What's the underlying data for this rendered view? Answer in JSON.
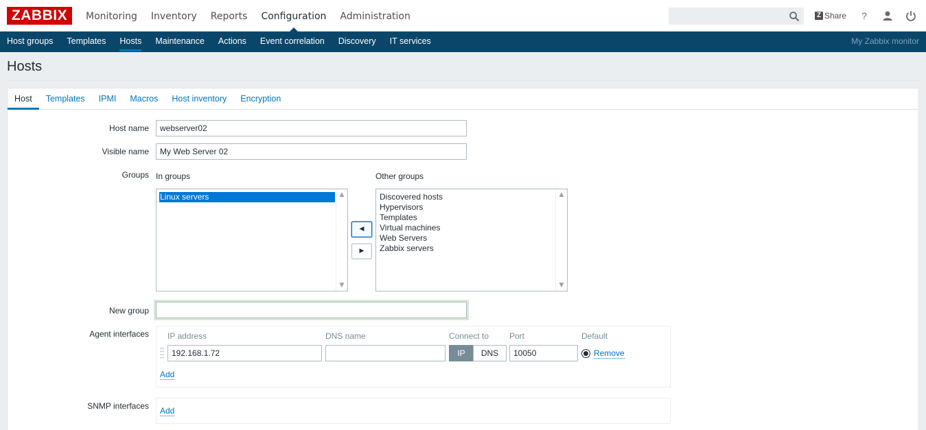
{
  "logo": "ZABBIX",
  "main_menu": [
    "Monitoring",
    "Inventory",
    "Reports",
    "Configuration",
    "Administration"
  ],
  "main_menu_active": "Configuration",
  "search": {
    "value": "",
    "placeholder": ""
  },
  "share_label": "Share",
  "sub_menu": [
    "Host groups",
    "Templates",
    "Hosts",
    "Maintenance",
    "Actions",
    "Event correlation",
    "Discovery",
    "IT services"
  ],
  "sub_menu_active": "Hosts",
  "server_name": "My Zabbix monitor",
  "page_title": "Hosts",
  "tabs": [
    "Host",
    "Templates",
    "IPMI",
    "Macros",
    "Host inventory",
    "Encryption"
  ],
  "tabs_active": "Host",
  "form": {
    "host_name_label": "Host name",
    "host_name_value": "webserver02",
    "visible_name_label": "Visible name",
    "visible_name_value": "My Web Server 02",
    "groups_label": "Groups",
    "in_groups_label": "In groups",
    "other_groups_label": "Other groups",
    "in_groups": [
      "Linux servers"
    ],
    "other_groups": [
      "Discovered hosts",
      "Hypervisors",
      "Templates",
      "Virtual machines",
      "Web Servers",
      "Zabbix servers"
    ],
    "new_group_label": "New group",
    "new_group_value": "",
    "agent_interfaces_label": "Agent interfaces",
    "snmp_interfaces_label": "SNMP interfaces"
  },
  "interfaces": {
    "headers": {
      "ip": "IP address",
      "dns": "DNS name",
      "connect": "Connect to",
      "port": "Port",
      "default": "Default"
    },
    "agent": {
      "ip": "192.168.1.72",
      "dns": "",
      "connect_ip": "IP",
      "connect_dns": "DNS",
      "port": "10050",
      "remove": "Remove"
    },
    "add_label": "Add"
  },
  "colors": {
    "brand": "#d40000",
    "nav": "#0a466a",
    "link": "#0275b8"
  }
}
